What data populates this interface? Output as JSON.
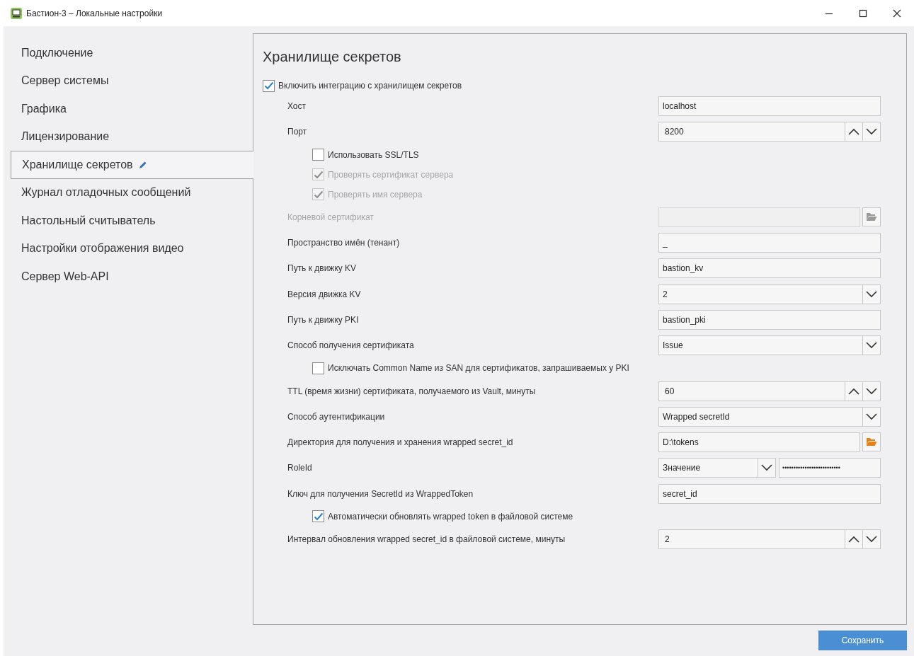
{
  "window": {
    "title": "Бастион-3 – Локальные настройки"
  },
  "sidebar": {
    "items": [
      {
        "label": "Подключение",
        "selected": false
      },
      {
        "label": "Сервер системы",
        "selected": false
      },
      {
        "label": "Графика",
        "selected": false
      },
      {
        "label": "Лицензирование",
        "selected": false
      },
      {
        "label": "Хранилище секретов",
        "selected": true
      },
      {
        "label": "Журнал отладочных сообщений",
        "selected": false
      },
      {
        "label": "Настольный считыватель",
        "selected": false
      },
      {
        "label": "Настройки отображения видео",
        "selected": false
      },
      {
        "label": "Сервер Web-API",
        "selected": false
      }
    ]
  },
  "panel": {
    "title": "Хранилище секретов",
    "integration": {
      "label": "Включить интеграцию с хранилищем секретов",
      "checked": true,
      "rows": [
        {
          "kind": "text",
          "label": "Хост",
          "value": "localhost",
          "disabled": false
        },
        {
          "kind": "spin",
          "label": "Порт",
          "value": "8200",
          "disabled": false
        },
        {
          "kind": "checkbox",
          "label": "Использовать SSL/TLS",
          "checked": false,
          "disabled": false
        },
        {
          "kind": "checkbox",
          "label": "Проверять сертификат сервера",
          "checked": true,
          "disabled": true
        },
        {
          "kind": "checkbox",
          "label": "Проверять имя сервера",
          "checked": true,
          "disabled": true
        },
        {
          "kind": "file",
          "label": "Корневой сертификат",
          "disabled": true
        },
        {
          "kind": "text",
          "label": "Пространство имён (тенант)",
          "value": "_",
          "disabled": false
        },
        {
          "kind": "text",
          "label": "Путь к движку KV",
          "value": "bastion_kv",
          "disabled": false
        },
        {
          "kind": "combo",
          "label": "Версия движка KV",
          "value": "2",
          "disabled": false
        },
        {
          "kind": "text",
          "label": "Путь к движку PKI",
          "value": "bastion_pki",
          "disabled": false
        },
        {
          "kind": "combo",
          "label": "Способ получения сертификата",
          "value": "Issue",
          "disabled": false
        },
        {
          "kind": "checkbox",
          "label": "Исключать Common Name из SAN для сертификатов, запрашиваемых у PKI",
          "checked": false,
          "disabled": false
        },
        {
          "kind": "spin",
          "label": "TTL (время жизни) сертификата, получаемого из Vault, минуты",
          "value": "60",
          "disabled": false
        },
        {
          "kind": "combo",
          "label": "Способ аутентификации",
          "value": "Wrapped secretId",
          "disabled": false
        },
        {
          "kind": "file",
          "label": "Директория для получения и хранения wrapped secret_id",
          "value": "D:\\tokens",
          "disabled": false
        },
        {
          "kind": "pair",
          "label": "RoleId",
          "value": "Значение",
          "secret": "••••••••••••••••••••••••••",
          "disabled": false
        },
        {
          "kind": "text",
          "label": "Ключ для получения SecretId из WrappedToken",
          "value": "secret_id",
          "disabled": false
        },
        {
          "kind": "checkbox",
          "label": "Автоматически обновлять wrapped token в файловой системе",
          "checked": true,
          "disabled": false
        },
        {
          "kind": "spin",
          "label": "Интервал обновления wrapped secret_id в файловой системе, минуты",
          "value": "2",
          "disabled": false
        }
      ]
    }
  },
  "save_button": "Сохранить"
}
